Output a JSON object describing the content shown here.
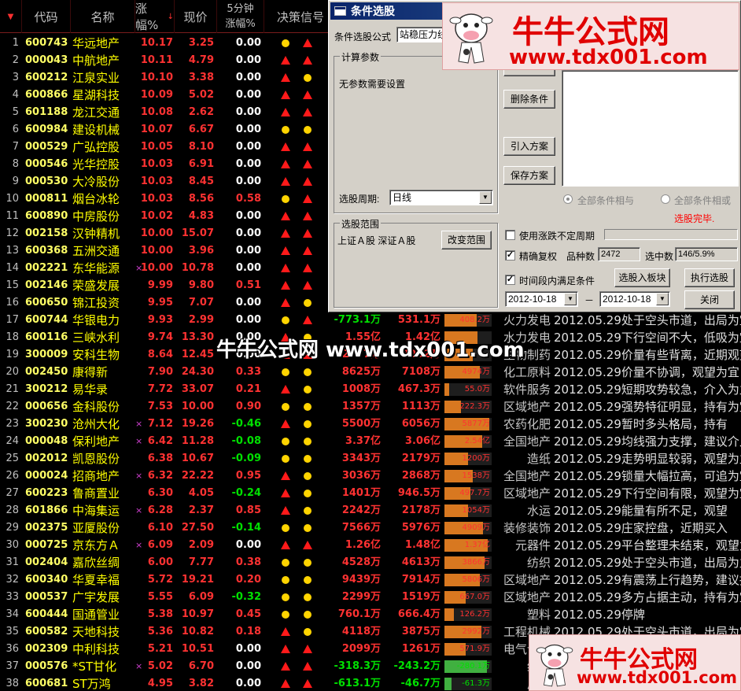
{
  "headers": {
    "code": "代码",
    "name": "名称",
    "pct": "涨幅%",
    "price": "现价",
    "min5_top": "5分钟",
    "min5_bot": "涨幅%",
    "signal": "决策信号"
  },
  "rows": [
    {
      "n": "1",
      "code": "600743",
      "name": "华远地产",
      "mk": "",
      "pct": "10.17",
      "price": "3.25",
      "f5": "0.00",
      "s1": "circ",
      "s2": "tri"
    },
    {
      "n": "2",
      "code": "000043",
      "name": "中航地产",
      "mk": "",
      "pct": "10.11",
      "price": "4.79",
      "f5": "0.00",
      "s1": "tri",
      "s2": "tri"
    },
    {
      "n": "3",
      "code": "600212",
      "name": "江泉实业",
      "mk": "",
      "pct": "10.10",
      "price": "3.38",
      "f5": "0.00",
      "s1": "tri",
      "s2": "circ"
    },
    {
      "n": "4",
      "code": "600866",
      "name": "星湖科技",
      "mk": "",
      "pct": "10.09",
      "price": "5.02",
      "f5": "0.00",
      "s1": "tri",
      "s2": "tri"
    },
    {
      "n": "5",
      "code": "601188",
      "name": "龙江交通",
      "mk": "",
      "pct": "10.08",
      "price": "2.62",
      "f5": "0.00",
      "s1": "tri",
      "s2": "tri"
    },
    {
      "n": "6",
      "code": "600984",
      "name": "建设机械",
      "mk": "",
      "pct": "10.07",
      "price": "6.67",
      "f5": "0.00",
      "s1": "circ",
      "s2": "circ"
    },
    {
      "n": "7",
      "code": "000529",
      "name": "广弘控股",
      "mk": "",
      "pct": "10.05",
      "price": "8.10",
      "f5": "0.00",
      "s1": "tri",
      "s2": "tri"
    },
    {
      "n": "8",
      "code": "000546",
      "name": "光华控股",
      "mk": "",
      "pct": "10.03",
      "price": "6.91",
      "f5": "0.00",
      "s1": "tri",
      "s2": "tri"
    },
    {
      "n": "9",
      "code": "000530",
      "name": "大冷股份",
      "mk": "",
      "pct": "10.03",
      "price": "8.45",
      "f5": "0.00",
      "s1": "tri",
      "s2": "tri"
    },
    {
      "n": "10",
      "code": "000811",
      "name": "烟台冰轮",
      "mk": "",
      "pct": "10.03",
      "price": "8.56",
      "f5": "0.58",
      "s1": "circ",
      "s2": "tri"
    },
    {
      "n": "11",
      "code": "600890",
      "name": "中房股份",
      "mk": "",
      "pct": "10.02",
      "price": "4.83",
      "f5": "0.00",
      "s1": "tri",
      "s2": "tri"
    },
    {
      "n": "12",
      "code": "002158",
      "name": "汉钟精机",
      "mk": "",
      "pct": "10.00",
      "price": "15.07",
      "f5": "0.00",
      "s1": "tri",
      "s2": "tri"
    },
    {
      "n": "13",
      "code": "600368",
      "name": "五洲交通",
      "mk": "",
      "pct": "10.00",
      "price": "3.96",
      "f5": "0.00",
      "s1": "tri",
      "s2": "tri"
    },
    {
      "n": "14",
      "code": "002221",
      "name": "东华能源",
      "mk": "×",
      "pct": "10.00",
      "price": "10.78",
      "f5": "0.00",
      "s1": "tri",
      "s2": "tri"
    },
    {
      "n": "15",
      "code": "002146",
      "name": "荣盛发展",
      "mk": "",
      "pct": "9.99",
      "price": "9.80",
      "f5": "0.51",
      "s1": "tri",
      "s2": "tri"
    },
    {
      "n": "16",
      "code": "600650",
      "name": "锦江投资",
      "mk": "",
      "pct": "9.95",
      "price": "7.07",
      "f5": "0.00",
      "s1": "tri",
      "s2": "circ"
    },
    {
      "n": "17",
      "code": "600744",
      "name": "华银电力",
      "mk": "",
      "pct": "9.93",
      "price": "2.99",
      "f5": "0.00",
      "s1": "circ",
      "s2": "tri",
      "vol": "-773.1万",
      "amt": "531.1万",
      "bar": "408.2万",
      "barv": 0.68,
      "barc": "#d87820",
      "ind": "火力发电",
      "note": "2012.05.29处于空头市道，出局为宜"
    },
    {
      "n": "18",
      "code": "600116",
      "name": "三峡水利",
      "mk": "",
      "pct": "9.74",
      "price": "13.30",
      "f5": "0.00",
      "s1": "tri",
      "s2": "circ",
      "vol": "1.55亿",
      "amt": "1.42亿",
      "bar": "",
      "barv": 0.7,
      "barc": "#d87820",
      "ind": "水力发电",
      "note": "2012.05.29下行空间不大，低吸为宜"
    },
    {
      "n": "19",
      "code": "300009",
      "name": "安科生物",
      "mk": "",
      "pct": "8.64",
      "price": "12.45",
      "f5": "0.00",
      "s1": "tri",
      "s2": "tri",
      "vol": "2777万",
      "amt": "2052万",
      "bar": "",
      "barv": 0.6,
      "barc": "#d87820",
      "ind": "生物制药",
      "note": "2012.05.29价量有些背离，近期观望"
    },
    {
      "n": "20",
      "code": "002450",
      "name": "康得新",
      "mk": "",
      "pct": "7.90",
      "price": "24.30",
      "f5": "0.33",
      "s1": "circ",
      "s2": "circ",
      "vol": "8625万",
      "amt": "7108万",
      "bar": "4974万",
      "barv": 0.75,
      "barc": "#d87820",
      "ind": "化工原料",
      "note": "2012.05.29价量不协调，观望为宜"
    },
    {
      "n": "21",
      "code": "300212",
      "name": "易华录",
      "mk": "",
      "pct": "7.72",
      "price": "33.07",
      "f5": "0.21",
      "s1": "tri",
      "s2": "circ",
      "vol": "1008万",
      "amt": "467.3万",
      "bar": "55.0万",
      "barv": 0.1,
      "barc": "#d87820",
      "ind": "软件服务",
      "note": "2012.05.29短期攻势较急，介入为主"
    },
    {
      "n": "22",
      "code": "000656",
      "name": "金科股份",
      "mk": "",
      "pct": "7.53",
      "price": "10.00",
      "f5": "0.90",
      "s1": "circ",
      "s2": "circ",
      "vol": "1357万",
      "amt": "1113万",
      "bar": "222.3万",
      "barv": 0.35,
      "barc": "#d87820",
      "ind": "区域地产",
      "note": "2012.05.29强势特征明显，持有为宜"
    },
    {
      "n": "23",
      "code": "300230",
      "name": "沧州大化",
      "mk": "×",
      "pct": "7.12",
      "price": "19.26",
      "f5": "-0.46",
      "s1": "tri",
      "s2": "circ",
      "vol": "5500万",
      "amt": "6056万",
      "bar": "5877万",
      "barv": 0.95,
      "barc": "#d87820",
      "ind": "农药化肥",
      "note": "2012.05.29暂时多头格局，持有"
    },
    {
      "n": "24",
      "code": "000048",
      "name": "保利地产",
      "mk": "×",
      "pct": "6.42",
      "price": "11.28",
      "f5": "-0.08",
      "s1": "circ",
      "s2": "circ",
      "vol": "3.37亿",
      "amt": "3.06亿",
      "bar": "2.54亿",
      "barv": 0.8,
      "barc": "#d87820",
      "ind": "全国地产",
      "note": "2012.05.29均线强力支撑，建议介入"
    },
    {
      "n": "25",
      "code": "002012",
      "name": "凯恩股份",
      "mk": "",
      "pct": "6.38",
      "price": "10.67",
      "f5": "-0.09",
      "s1": "circ",
      "s2": "circ",
      "vol": "3343万",
      "amt": "2179万",
      "bar": "1200万",
      "barv": 0.5,
      "barc": "#d87820",
      "ind": "造纸",
      "note": "2012.05.29走势明显较弱，观望为主"
    },
    {
      "n": "26",
      "code": "000024",
      "name": "招商地产",
      "mk": "×",
      "pct": "6.32",
      "price": "22.22",
      "f5": "0.95",
      "s1": "tri",
      "s2": "circ",
      "vol": "3036万",
      "amt": "2868万",
      "bar": "1538万",
      "barv": 0.6,
      "barc": "#d87820",
      "ind": "全国地产",
      "note": "2012.05.29锁量大幅拉高，可追为宜"
    },
    {
      "n": "27",
      "code": "600223",
      "name": "鲁商置业",
      "mk": "",
      "pct": "6.30",
      "price": "4.05",
      "f5": "-0.24",
      "s1": "tri",
      "s2": "circ",
      "vol": "1401万",
      "amt": "946.5万",
      "bar": "497.7万",
      "barv": 0.55,
      "barc": "#d87820",
      "ind": "区域地产",
      "note": "2012.05.29下行空间有限，观望为宜"
    },
    {
      "n": "28",
      "code": "601866",
      "name": "中海集运",
      "mk": "×",
      "pct": "6.28",
      "price": "2.37",
      "f5": "0.85",
      "s1": "tri",
      "s2": "circ",
      "vol": "2242万",
      "amt": "2178万",
      "bar": "1054万",
      "barv": 0.5,
      "barc": "#d87820",
      "ind": "水运",
      "note": "2012.05.29能量有所不足，观望"
    },
    {
      "n": "29",
      "code": "002375",
      "name": "亚厦股份",
      "mk": "",
      "pct": "6.10",
      "price": "27.50",
      "f5": "-0.14",
      "s1": "circ",
      "s2": "circ",
      "vol": "7566万",
      "amt": "5976万",
      "bar": "4909万",
      "barv": 0.82,
      "barc": "#d87820",
      "ind": "装修装饰",
      "note": "2012.05.29庄家控盘，近期买入"
    },
    {
      "n": "30",
      "code": "000725",
      "name": "京东方Ａ",
      "mk": "×",
      "pct": "6.09",
      "price": "2.09",
      "f5": "0.00",
      "s1": "tri",
      "s2": "tri",
      "vol": "1.26亿",
      "amt": "1.48亿",
      "bar": "1.37亿",
      "barv": 0.92,
      "barc": "#d87820",
      "ind": "元器件",
      "note": "2012.05.29平台整理未结束，观望为宜"
    },
    {
      "n": "31",
      "code": "002404",
      "name": "嘉欣丝绸",
      "mk": "",
      "pct": "6.00",
      "price": "7.77",
      "f5": "0.38",
      "s1": "circ",
      "s2": "circ",
      "vol": "4528万",
      "amt": "4613万",
      "bar": "3866万",
      "barv": 0.85,
      "barc": "#d87820",
      "ind": "纺织",
      "note": "2012.05.29处于空头市道，出局为主"
    },
    {
      "n": "32",
      "code": "600340",
      "name": "华夏幸福",
      "mk": "",
      "pct": "5.72",
      "price": "19.21",
      "f5": "0.20",
      "s1": "circ",
      "s2": "circ",
      "vol": "9439万",
      "amt": "7914万",
      "bar": "5806万",
      "barv": 0.75,
      "barc": "#d87820",
      "ind": "区域地产",
      "note": "2012.05.29有震荡上行趋势，建议持有"
    },
    {
      "n": "33",
      "code": "000537",
      "name": "广宇发展",
      "mk": "",
      "pct": "5.55",
      "price": "6.09",
      "f5": "-0.32",
      "s1": "circ",
      "s2": "circ",
      "vol": "2299万",
      "amt": "1519万",
      "bar": "667.0万",
      "barv": 0.45,
      "barc": "#d87820",
      "ind": "区域地产",
      "note": "2012.05.29多方占据主动，持有为宜"
    },
    {
      "n": "34",
      "code": "600444",
      "name": "国通管业",
      "mk": "",
      "pct": "5.38",
      "price": "10.97",
      "f5": "0.45",
      "s1": "circ",
      "s2": "circ",
      "vol": "760.1万",
      "amt": "666.4万",
      "bar": "126.2万",
      "barv": 0.2,
      "barc": "#d87820",
      "ind": "塑料",
      "note": "2012.05.29停牌"
    },
    {
      "n": "35",
      "code": "600582",
      "name": "天地科技",
      "mk": "",
      "pct": "5.36",
      "price": "10.82",
      "f5": "0.18",
      "s1": "tri",
      "s2": "circ",
      "vol": "4118万",
      "amt": "3875万",
      "bar": "2992万",
      "barv": 0.78,
      "barc": "#d87820",
      "ind": "工程机械",
      "note": "2012.05.29处于空头市道，出局为宜"
    },
    {
      "n": "36",
      "code": "002309",
      "name": "中利科技",
      "mk": "",
      "pct": "5.21",
      "price": "10.51",
      "f5": "0.00",
      "s1": "tri",
      "s2": "tri",
      "vol": "2099万",
      "amt": "1261万",
      "bar": "571.9万",
      "barv": 0.45,
      "barc": "#d87820",
      "ind": "电气设备",
      "note": ""
    },
    {
      "n": "37",
      "code": "000576",
      "name": "*ST甘化",
      "mk": "×",
      "pct": "5.02",
      "price": "6.70",
      "f5": "0.00",
      "s1": "tri",
      "s2": "tri",
      "vol": "-318.3万",
      "amt": "-243.2万",
      "bar": "-280.1万",
      "barv": 0.9,
      "barc": "#40b040",
      "ind": "纺织",
      "note": ""
    },
    {
      "n": "38",
      "code": "600681",
      "name": "ST万鸿",
      "mk": "",
      "pct": "4.95",
      "price": "3.82",
      "f5": "0.00",
      "s1": "tri",
      "s2": "tri",
      "vol": "-613.1万",
      "amt": "-46.7万",
      "bar": "-61.3万",
      "barv": 0.15,
      "barc": "#40b040",
      "ind": "广告",
      "note": ""
    }
  ],
  "dialog": {
    "title": "条件选股",
    "formula_label": "条件选股公式",
    "formula_value": "站稳压力线",
    "params_group": "计算参数",
    "params_text": "无参数需要设置",
    "btn_delete": "删除条件",
    "btn_import": "引入方案",
    "btn_save": "保存方案",
    "period_label": "选股周期:",
    "period_value": "日线",
    "radio_and": "全部条件相与",
    "radio_or": "全部条件相或",
    "status": "选股完毕.",
    "range_group": "选股范围",
    "range_text": "上证Ａ股 深证Ａ股",
    "btn_range": "改变范围",
    "chk_limit": "使用涨跌不定周期",
    "chk_fq": "精确复权",
    "count_label": "品种数",
    "count_value": "2472",
    "selected_label": "选中数",
    "selected_value": "146/5.9%",
    "chk_time": "时间段内满足条件",
    "btn_to_block": "选股入板块",
    "btn_run": "执行选股",
    "date_from": "2012-10-18",
    "date_sep": "－",
    "date_to": "2012-10-18",
    "btn_close": "关闭"
  },
  "watermark": {
    "brand": "牛牛公式网",
    "url": "www.tdx001.com",
    "mid": "牛牛公式网 www.tdx001.com"
  }
}
